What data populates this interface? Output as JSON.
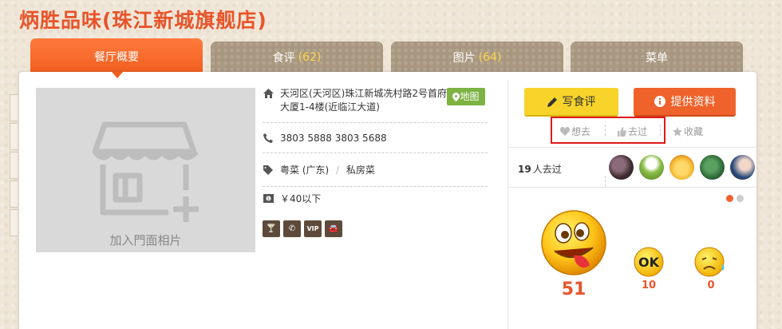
{
  "shop": {
    "title": "炳胜品味(珠江新城旗舰店)"
  },
  "tabs": [
    {
      "label": "餐厅概要",
      "count": "",
      "active": true
    },
    {
      "label": "食评",
      "count": "(62)",
      "active": false
    },
    {
      "label": "图片",
      "count": "(64)",
      "active": false
    },
    {
      "label": "菜单",
      "count": "",
      "active": false
    }
  ],
  "photo": {
    "add_label": "加入門面相片"
  },
  "info": {
    "address": "天河区(天河区)珠江新城冼村路2号首府大厦1-4楼(近临江大道)",
    "map_label": "地图",
    "phone": "3803 5888 3803 5688",
    "cuisine": [
      "粤菜 (广东)",
      "私房菜"
    ],
    "cuisine_sep": "/",
    "price": "￥40以下",
    "facilities": [
      {
        "icon": "cocktail-icon",
        "glyph": "🍸"
      },
      {
        "icon": "phone-booking-icon",
        "glyph": "✆"
      },
      {
        "icon": "vip-icon",
        "glyph": "VIP"
      },
      {
        "icon": "parking-car-icon",
        "glyph": "🚘"
      }
    ]
  },
  "actions": {
    "write_review": "写食评",
    "provide_info": "提供资料",
    "want_to_go": "想去",
    "been_there": "去过",
    "favorite": "收藏"
  },
  "visited": {
    "count": "19",
    "label": "人去过"
  },
  "avatars": [
    {
      "name": "avatar-user-1",
      "color": "#3b2a2e"
    },
    {
      "name": "avatar-user-2",
      "color": "#8dbf4a"
    },
    {
      "name": "avatar-user-3",
      "color": "#f3b52b"
    },
    {
      "name": "avatar-user-4",
      "color": "#2f6b3a"
    },
    {
      "name": "avatar-user-5",
      "color": "#2b4b7a"
    }
  ],
  "ratings": [
    {
      "name": "rating-yummy",
      "value": "51"
    },
    {
      "name": "rating-ok",
      "value": "10",
      "face_text": "OK"
    },
    {
      "name": "rating-bad",
      "value": "0"
    }
  ],
  "colors": {
    "brand": "#e8542a",
    "tab_active": "#f05d1d",
    "write_button": "#f8d32a",
    "info_button": "#f0622b",
    "map_button": "#7cb342",
    "highlight_box": "#e01818",
    "dot_active": "#f0622b",
    "dot_inactive": "#cccccc"
  }
}
